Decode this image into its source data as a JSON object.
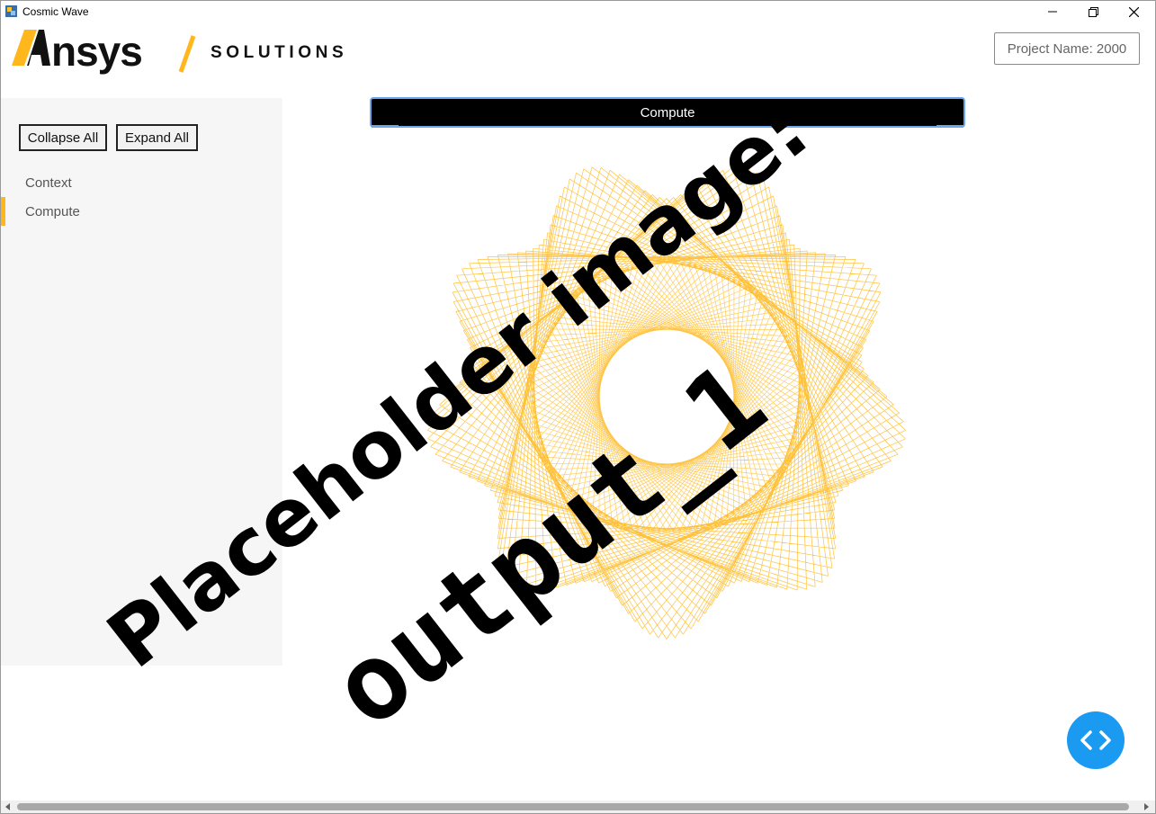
{
  "window": {
    "title": "Cosmic Wave",
    "controls": [
      "minimize",
      "restore",
      "close"
    ]
  },
  "header": {
    "brand": "Ansys",
    "section": "SOLUTIONS",
    "project_name": "Project Name: 2000"
  },
  "sidebar": {
    "collapse_label": "Collapse All",
    "expand_label": "Expand All",
    "items": [
      {
        "label": "Context",
        "active": false
      },
      {
        "label": "Compute",
        "active": true
      }
    ]
  },
  "main": {
    "compute_label": "Compute",
    "placeholder_line1": "Placeholder image:",
    "placeholder_line2": "output_1"
  },
  "colors": {
    "accent": "#ffb71b",
    "fab": "#1a9af0",
    "focus": "#6aa7ec"
  },
  "icons": {
    "fab": "code-icon"
  }
}
